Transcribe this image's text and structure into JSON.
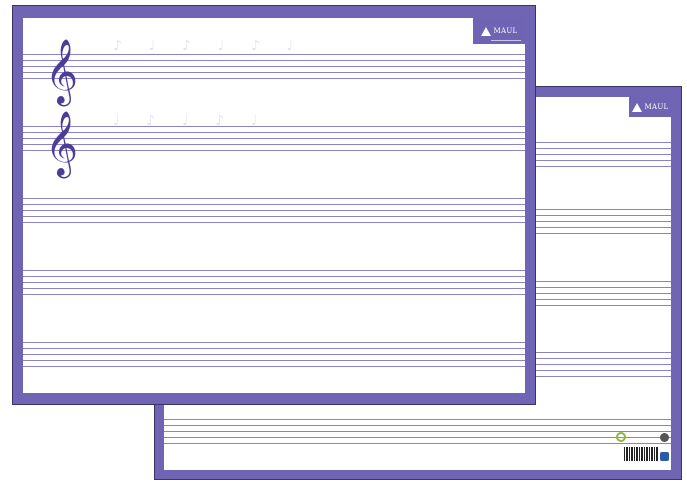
{
  "brand": {
    "logo_text": "MAUL",
    "accent_color": "#7064b4",
    "staff_line_color": "#8b84c8",
    "clef_color": "#4c3e96"
  },
  "front_board": {
    "clef_symbol": "𝄞",
    "clef_count": 2
  },
  "back_board": {
    "logo_text": "MAUL"
  }
}
